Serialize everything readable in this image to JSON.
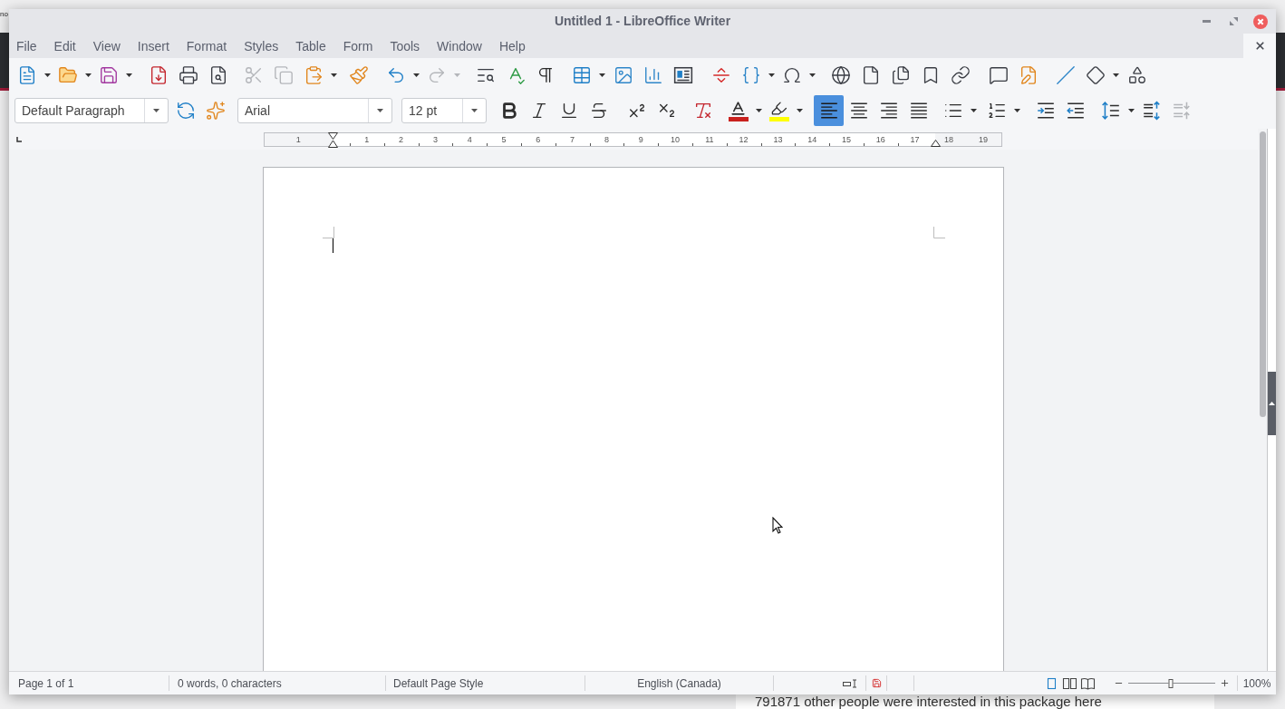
{
  "background_page": {
    "top_left_text": "no",
    "bottom_text": "791871 other people were interested in this package here"
  },
  "window": {
    "title": "Untitled 1 - LibreOffice Writer"
  },
  "menu_bar": [
    "File",
    "Edit",
    "View",
    "Insert",
    "Format",
    "Styles",
    "Table",
    "Form",
    "Tools",
    "Window",
    "Help"
  ],
  "standard_toolbar": [
    {
      "kind": "new",
      "dropdown": true,
      "disabled": false
    },
    {
      "kind": "open",
      "dropdown": true,
      "disabled": false
    },
    {
      "kind": "save",
      "dropdown": true,
      "disabled": false
    },
    {
      "kind": "pdf",
      "dropdown": false,
      "disabled": false
    },
    {
      "kind": "print",
      "dropdown": false,
      "disabled": false
    },
    {
      "kind": "preview",
      "dropdown": false,
      "disabled": false
    },
    {
      "kind": "cut",
      "dropdown": false,
      "disabled": true
    },
    {
      "kind": "copy",
      "dropdown": false,
      "disabled": true
    },
    {
      "kind": "paste",
      "dropdown": true,
      "disabled": false
    },
    {
      "kind": "clone",
      "dropdown": false,
      "disabled": false
    },
    {
      "kind": "undo",
      "dropdown": true,
      "disabled": false
    },
    {
      "kind": "redo",
      "dropdown": true,
      "disabled": true
    },
    {
      "kind": "find",
      "dropdown": false,
      "disabled": false
    },
    {
      "kind": "spelling",
      "dropdown": false,
      "disabled": false
    },
    {
      "kind": "marks",
      "dropdown": false,
      "disabled": false
    },
    {
      "kind": "table",
      "dropdown": true,
      "disabled": false
    },
    {
      "kind": "image",
      "dropdown": false,
      "disabled": false
    },
    {
      "kind": "chart",
      "dropdown": false,
      "disabled": false
    },
    {
      "kind": "textbox",
      "dropdown": false,
      "disabled": false
    },
    {
      "kind": "pagebreak",
      "dropdown": false,
      "disabled": false
    },
    {
      "kind": "field",
      "dropdown": true,
      "disabled": false
    },
    {
      "kind": "special",
      "dropdown": true,
      "disabled": false
    },
    {
      "kind": "hyperlink",
      "dropdown": false,
      "disabled": false
    },
    {
      "kind": "footnote",
      "dropdown": false,
      "disabled": false
    },
    {
      "kind": "endnote",
      "dropdown": false,
      "disabled": false
    },
    {
      "kind": "bookmark",
      "dropdown": false,
      "disabled": false
    },
    {
      "kind": "crossref",
      "dropdown": false,
      "disabled": false
    },
    {
      "kind": "comment",
      "dropdown": false,
      "disabled": false
    },
    {
      "kind": "track",
      "dropdown": false,
      "disabled": false
    },
    {
      "kind": "line",
      "dropdown": false,
      "disabled": false
    },
    {
      "kind": "shapes",
      "dropdown": true,
      "disabled": false
    },
    {
      "kind": "draw",
      "dropdown": false,
      "disabled": false
    }
  ],
  "formatting_toolbar": {
    "paragraph_style": {
      "value": "Default Paragraph"
    },
    "style_buttons": [
      {
        "kind": "update",
        "dropdown": false,
        "disabled": false
      },
      {
        "kind": "newstyle",
        "dropdown": false,
        "disabled": false
      }
    ],
    "font_name": {
      "value": "Arial"
    },
    "font_size": {
      "value": "12 pt"
    },
    "character_buttons": [
      {
        "kind": "bold",
        "dropdown": false,
        "disabled": false
      },
      {
        "kind": "italic",
        "dropdown": false,
        "disabled": false
      },
      {
        "kind": "underline",
        "dropdown": false,
        "disabled": false
      },
      {
        "kind": "strike",
        "dropdown": false,
        "disabled": false
      },
      {
        "kind": "superscript",
        "dropdown": false,
        "disabled": false
      },
      {
        "kind": "subscript",
        "dropdown": false,
        "disabled": false
      },
      {
        "kind": "clear",
        "dropdown": false,
        "disabled": false
      },
      {
        "kind": "fontcolor",
        "dropdown": true,
        "disabled": false
      },
      {
        "kind": "highlight",
        "dropdown": true,
        "disabled": false
      }
    ],
    "alignment": [
      {
        "kind": "left",
        "selected": true
      },
      {
        "kind": "center",
        "selected": false
      },
      {
        "kind": "right",
        "selected": false
      },
      {
        "kind": "justify",
        "selected": false
      }
    ],
    "paragraph_buttons": [
      {
        "kind": "bullets",
        "dropdown": true,
        "disabled": false
      },
      {
        "kind": "numbering",
        "dropdown": true,
        "disabled": false
      },
      {
        "kind": "indent",
        "dropdown": false,
        "disabled": false
      },
      {
        "kind": "outdent",
        "dropdown": false,
        "disabled": false
      },
      {
        "kind": "linespacing",
        "dropdown": true,
        "disabled": false
      },
      {
        "kind": "spacingup",
        "dropdown": false,
        "disabled": false
      },
      {
        "kind": "spacingdown",
        "dropdown": false,
        "disabled": true
      }
    ]
  },
  "ruler": {
    "left_margin_labels": [
      "1"
    ],
    "labels": [
      "1",
      "2",
      "3",
      "4",
      "5",
      "6",
      "7",
      "8",
      "9",
      "10",
      "11",
      "12",
      "13",
      "14",
      "15",
      "16",
      "17"
    ],
    "right_margin_labels": [
      "18",
      "19"
    ]
  },
  "status_bar": {
    "page": "Page 1 of 1",
    "words": "0 words, 0 characters",
    "page_style": "Default Page Style",
    "language": "English (Canada)",
    "modified": true,
    "view_layouts": [
      {
        "kind": "single",
        "selected": true
      },
      {
        "kind": "multi",
        "selected": false
      },
      {
        "kind": "book",
        "selected": false
      }
    ],
    "zoom": {
      "level": 0.49,
      "reading": "100%"
    }
  }
}
